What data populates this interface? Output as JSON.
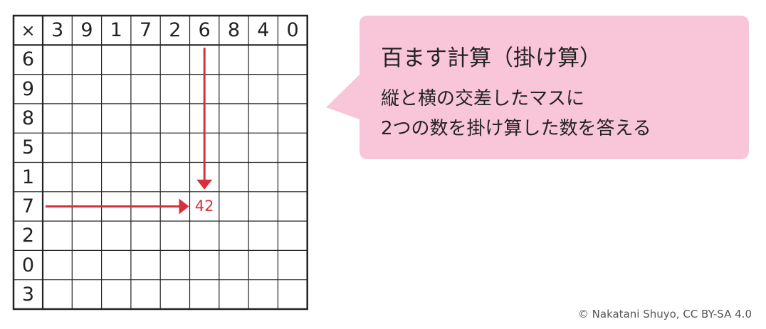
{
  "grid": {
    "operator": "×",
    "column_headers": [
      "3",
      "9",
      "1",
      "7",
      "2",
      "6",
      "8",
      "4",
      "0"
    ],
    "row_headers": [
      "6",
      "9",
      "8",
      "5",
      "1",
      "7",
      "2",
      "0",
      "3"
    ],
    "example": {
      "row": "7",
      "column": "6",
      "answer": "42"
    }
  },
  "callout": {
    "title": "百ます計算（掛け算）",
    "line1": "縦と横の交差したマスに",
    "line2": "2つの数を掛け算した数を答える"
  },
  "credit": "© Nakatani Shuyo, CC BY-SA 4.0",
  "colors": {
    "arrow": "#d7303a",
    "callout_fill": "#f9c5d8",
    "grid_line": "#222222"
  }
}
